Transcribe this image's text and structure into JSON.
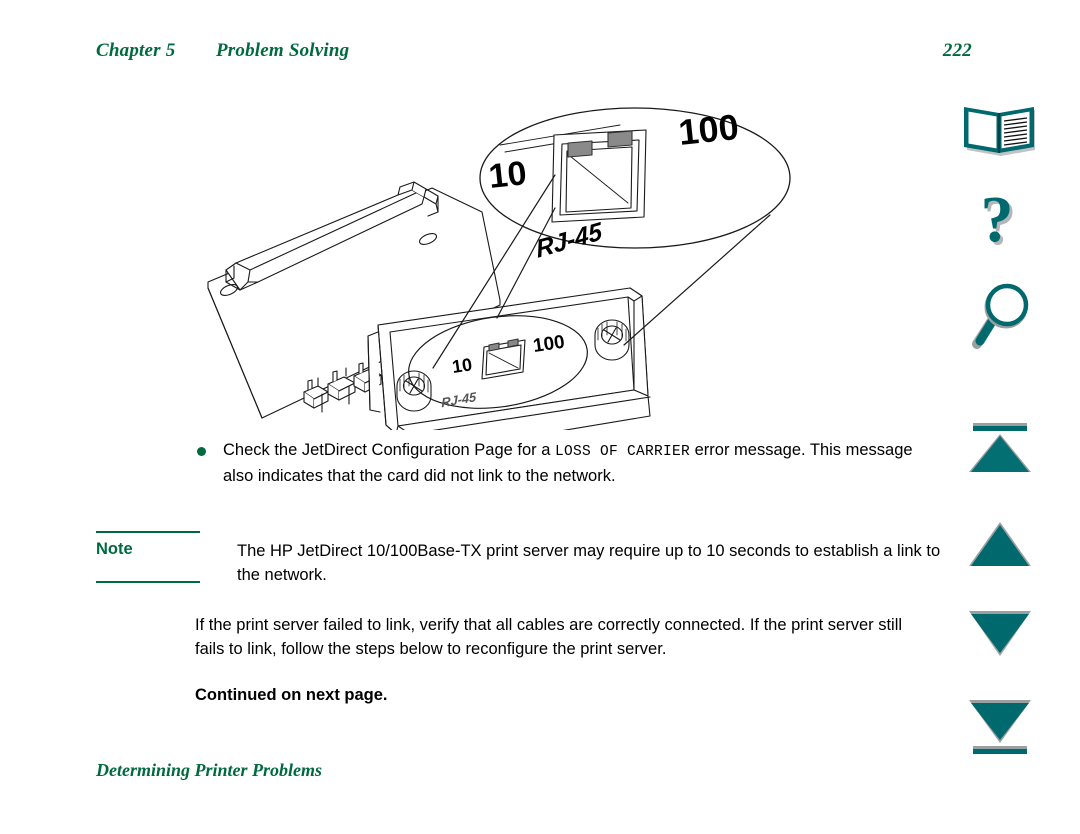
{
  "header": {
    "chapter_label": "Chapter 5",
    "chapter_title": "Problem Solving",
    "page_number": "222"
  },
  "illustration": {
    "name": "hp-jetdirect-card-rj45-diagram",
    "labels": {
      "led_10": "10",
      "led_100": "100",
      "port": "RJ-45",
      "callout_led_10": "10",
      "callout_led_100": "100",
      "callout_port": "RJ-45"
    }
  },
  "content": {
    "bullet": {
      "text_before": "Check the JetDirect Configuration Page for a ",
      "code": "LOSS OF CARRIER",
      "text_after": " error message. This message also indicates that the card did not link to the network."
    },
    "note": {
      "label": "Note",
      "text": "The HP JetDirect 10/100Base-TX print server may require up to 10 seconds to establish a link to the network."
    },
    "paragraph": "If the print server failed to link, verify that all cables are correctly connected. If the print server still fails to link, follow the steps below to reconfigure the print server.",
    "continued": "Continued on next page."
  },
  "footer": {
    "title": "Determining Printer Problems"
  },
  "icon_rail": {
    "items": [
      {
        "name": "contents-book-icon",
        "label": "Contents"
      },
      {
        "name": "help-question-icon",
        "label": "Help"
      },
      {
        "name": "search-magnifier-icon",
        "label": "Search"
      },
      {
        "name": "first-page-icon",
        "label": "First page"
      },
      {
        "name": "previous-page-icon",
        "label": "Previous page"
      },
      {
        "name": "next-page-icon",
        "label": "Next page"
      },
      {
        "name": "last-page-icon",
        "label": "Last page"
      }
    ]
  },
  "colors": {
    "green": "#00693e",
    "teal": "#00696e",
    "teal_dark": "#004f55",
    "gray_highlight": "#b8bcbd",
    "text": "#000000"
  }
}
